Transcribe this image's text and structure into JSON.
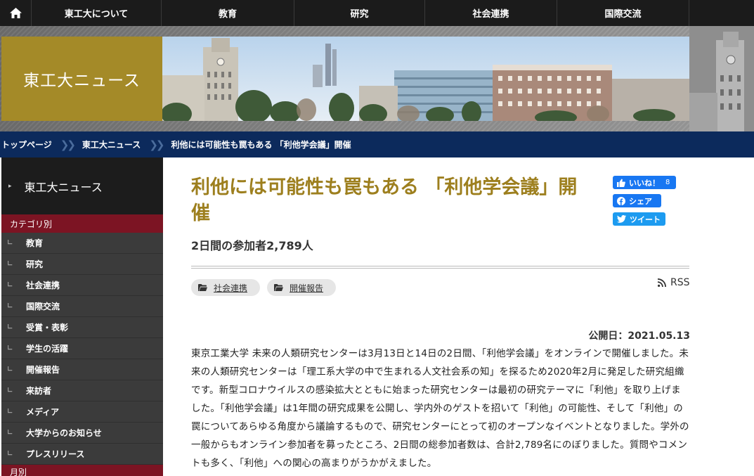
{
  "nav": {
    "items": [
      "東工大について",
      "教育",
      "研究",
      "社会連携",
      "国際交流"
    ]
  },
  "banner": {
    "title": "東工大ニュース"
  },
  "breadcrumb": [
    "トップページ",
    "東工大ニュース",
    "利他には可能性も罠もある 「利他学会議」開催"
  ],
  "sidebar": {
    "title": "東工大ニュース",
    "category_heading": "カテゴリ別",
    "categories": [
      "教育",
      "研究",
      "社会連携",
      "国際交流",
      "受賞・表彰",
      "学生の活躍",
      "開催報告",
      "来訪者",
      "メディア",
      "大学からのお知らせ",
      "プレスリリース"
    ],
    "month_heading": "月別"
  },
  "article": {
    "title": "利他には可能性も罠もある 「利他学会議」開催",
    "subtitle": "2日間の参加者2,789人",
    "tags": [
      "社会連携",
      "開催報告"
    ],
    "rss": "RSS",
    "published": "公開日：2021.05.13",
    "body": "東京工業大学 未来の人類研究センターは3月13日と14日の2日間、「利他学会議」をオンラインで開催しました。未来の人類研究センターは「理工系大学の中で生まれる人文社会系の知」を探るため2020年2月に発足した研究組織です。新型コロナウイルスの感染拡大とともに始まった研究センターは最初の研究テーマに「利他」を取り上げました。「利他学会議」は1年間の研究成果を公開し、学内外のゲストを招いて「利他」の可能性、そして「利他」の罠についてあらゆる角度から議論するもので、研究センターにとって初のオープンなイベントとなりました。学外の一般からもオンライン参加者を募ったところ、2日間の総参加者数は、合計2,789名にのぼりました。質問やコメントも多く、「利他」への関心の高まりがうかがえました。"
  },
  "social": {
    "like_label": "いいね！",
    "like_count": "8",
    "share_label": "シェア",
    "tweet_label": "ツイート"
  },
  "colors": {
    "gold": "#a48a28",
    "title_gold": "#9d7f1e",
    "navy": "#0c2a5c",
    "crimson": "#7c1423",
    "facebook": "#1877f2",
    "twitter": "#1d9bf0"
  },
  "icons": [
    "home-icon",
    "folder-icon",
    "rss-icon",
    "thumbs-up-icon",
    "facebook-icon",
    "twitter-icon"
  ]
}
